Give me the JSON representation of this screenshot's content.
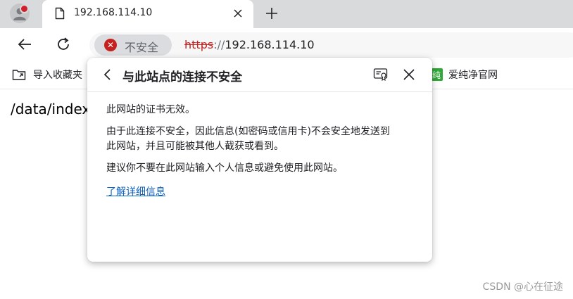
{
  "tab": {
    "title": "192.168.114.10"
  },
  "addressbar": {
    "security_label": "不安全",
    "url_scheme": "https",
    "url_sep": "://",
    "url_host": "192.168.114.10"
  },
  "favorites": [
    {
      "label": "导入收藏夹"
    },
    {
      "label": "爱纯净官网",
      "badge": "纯"
    }
  ],
  "content": {
    "path_text": "/data/index"
  },
  "popup": {
    "title": "与此站点的连接不安全",
    "para1": "此网站的证书无效。",
    "para2_line1": "由于此连接不安全，因此信息(如密码或信用卡)不会安全地发送到",
    "para2_line2": "此网站，并且可能被其他人截获或看到。",
    "para3": "建议你不要在此网站输入个人信息或避免使用此网站。",
    "learn_more": "了解详细信息"
  },
  "watermark": "CSDN @心在征途",
  "icons": {
    "profile": "profile-avatar-icon",
    "tab": "page-icon",
    "close": "close-icon",
    "new_tab": "plus-icon",
    "back": "arrow-left-icon",
    "refresh": "refresh-icon",
    "insecure": "error-x-icon",
    "import_favorites": "folder-import-icon",
    "popup_back": "chevron-left-icon",
    "certificate": "certificate-icon"
  },
  "colors": {
    "insecure_red": "#c5221f",
    "link_blue": "#0e62c1",
    "tabstrip_bg": "#d9dadc",
    "favorite_badge_green": "#2ea836"
  }
}
